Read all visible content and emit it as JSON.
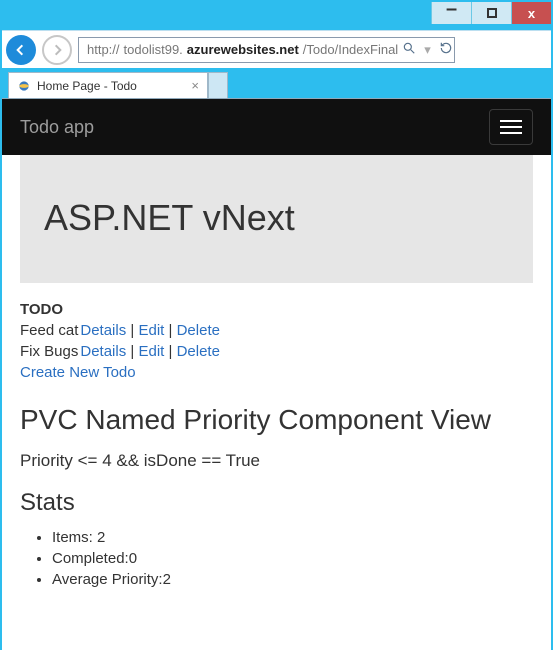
{
  "window": {
    "url_prefix": "http://",
    "url_host_pre": "todolist99.",
    "url_host_bold": "azurewebsites.net",
    "url_path": "/Todo/IndexFinal",
    "search_icon_name": "search-icon",
    "refresh_icon_name": "refresh-icon",
    "min": "–",
    "close": "x"
  },
  "tab": {
    "title": "Home Page - Todo"
  },
  "header": {
    "brand": "Todo app"
  },
  "jumbo": {
    "title": "ASP.NET vNext"
  },
  "todo": {
    "label": "TODO",
    "items": [
      {
        "name": "Feed cat",
        "details": "Details",
        "edit": "Edit",
        "del": "Delete"
      },
      {
        "name": "Fix Bugs",
        "details": "Details",
        "edit": "Edit",
        "del": "Delete"
      }
    ],
    "create": "Create New Todo"
  },
  "pvc": {
    "heading": "PVC Named Priority Component View",
    "expression": "Priority <= 4 && isDone == True"
  },
  "stats": {
    "heading": "Stats",
    "items_label": "Items: ",
    "items_value": "2",
    "completed_label": "Completed:",
    "completed_value": "0",
    "avg_label": "Average Priority:",
    "avg_value": "2"
  }
}
